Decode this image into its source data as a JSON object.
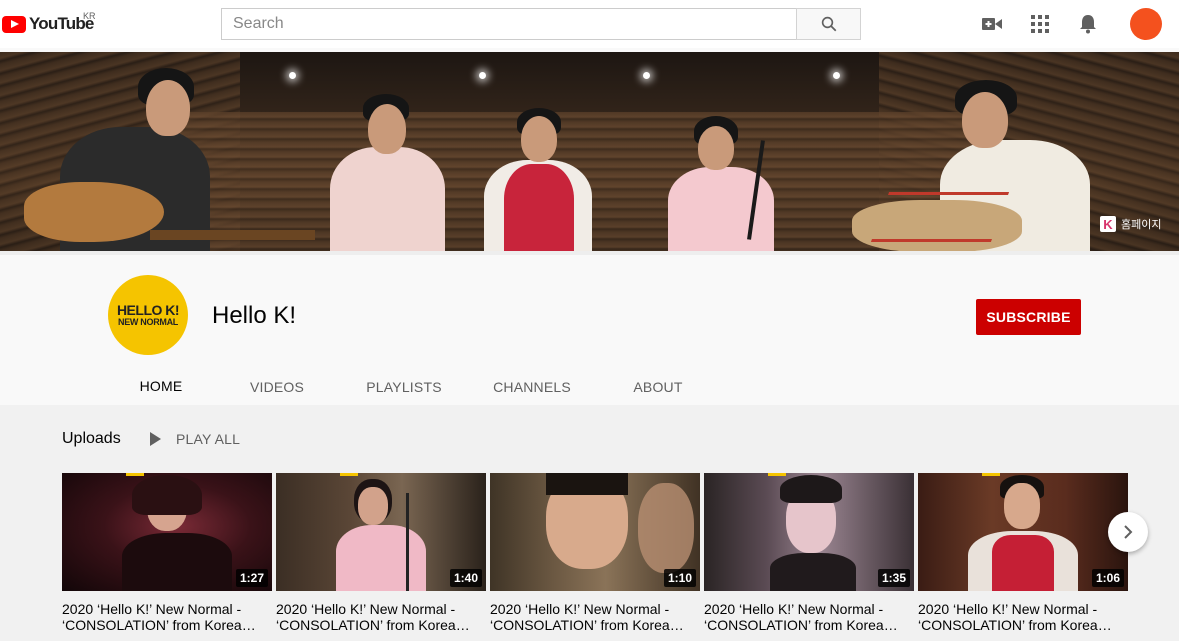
{
  "masthead": {
    "logo_text": "YouTube",
    "country_code": "KR",
    "search_placeholder": "Search",
    "icons": [
      "create-video-icon",
      "apps-grid-icon",
      "notifications-bell-icon",
      "account-avatar"
    ],
    "avatar_color": "#f4511e"
  },
  "banner": {
    "homepage_link_label": "홈페이지",
    "homepage_link_badge": "K"
  },
  "channel": {
    "name": "Hello K!",
    "avatar_line1": "HELLO K!",
    "avatar_line2": "NEW NORMAL",
    "avatar_color": "#f5c400",
    "subscribe_label": "SUBSCRIBE",
    "subscribe_color": "#cc0000",
    "tabs": [
      {
        "label": "HOME",
        "active": true
      },
      {
        "label": "VIDEOS",
        "active": false
      },
      {
        "label": "PLAYLISTS",
        "active": false
      },
      {
        "label": "CHANNELS",
        "active": false
      },
      {
        "label": "ABOUT",
        "active": false
      }
    ]
  },
  "uploads": {
    "title": "Uploads",
    "play_all_label": "PLAY ALL",
    "videos": [
      {
        "title_line1": "2020 ‘Hello K!’ New Normal -",
        "title_line2": "‘CONSOLATION’ from Korea…",
        "duration": "1:27"
      },
      {
        "title_line1": "2020 ‘Hello K!’ New Normal -",
        "title_line2": "‘CONSOLATION’ from Korea…",
        "duration": "1:40"
      },
      {
        "title_line1": "2020 ‘Hello K!’ New Normal -",
        "title_line2": "‘CONSOLATION’ from Korea…",
        "duration": "1:10"
      },
      {
        "title_line1": "2020 ‘Hello K!’ New Normal -",
        "title_line2": "‘CONSOLATION’ from Korea…",
        "duration": "1:35"
      },
      {
        "title_line1": "2020 ‘Hello K!’ New Normal -",
        "title_line2": "‘CONSOLATION’ from Korea…",
        "duration": "1:06"
      }
    ]
  }
}
